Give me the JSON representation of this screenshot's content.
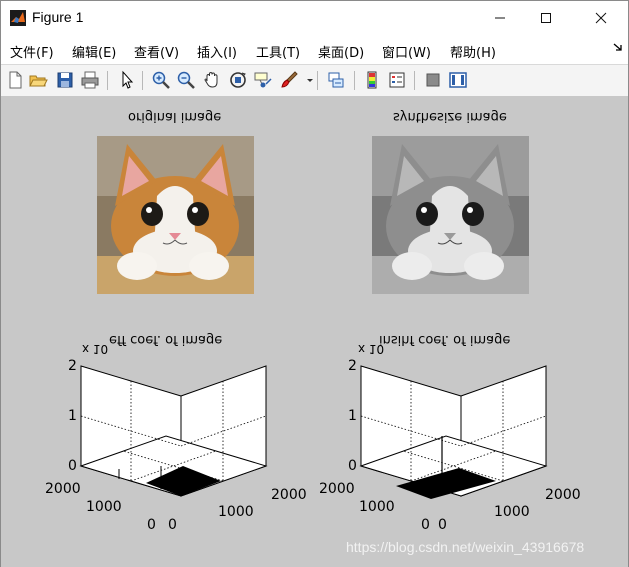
{
  "window": {
    "title": "Figure 1",
    "minimize_glyph": "—",
    "maximize_glyph": "☐",
    "close_glyph": "✕"
  },
  "menu": [
    {
      "label": "文件(F)"
    },
    {
      "label": "编辑(E)"
    },
    {
      "label": "查看(V)"
    },
    {
      "label": "插入(I)"
    },
    {
      "label": "工具(T)"
    },
    {
      "label": "桌面(D)"
    },
    {
      "label": "窗口(W)"
    },
    {
      "label": "帮助(H)"
    }
  ],
  "toolbar_icons": [
    "new-figure-icon",
    "open-file-icon",
    "save-icon",
    "print-icon",
    "pointer-icon",
    "zoom-in-icon",
    "zoom-out-icon",
    "pan-icon",
    "rotate-3d-icon",
    "data-cursor-icon",
    "brush-icon",
    "brush-dropdown-icon",
    "link-plot-icon",
    "colorbar-icon",
    "legend-icon",
    "hide-plot-tools-icon",
    "show-plot-tools-icon"
  ],
  "axes": [
    {
      "title": "original image",
      "image_type": "color cat photo"
    },
    {
      "title": "synthesize image",
      "image_type": "grayscale cat photo"
    }
  ],
  "plots": [
    {
      "title": "eff coef. of image",
      "exponent_label": "x 10",
      "z_ticks": [
        "0",
        "1",
        "2"
      ],
      "y_ticks": [
        "2000",
        "1000",
        "0"
      ],
      "x_ticks": [
        "0",
        "1000",
        "2000"
      ]
    },
    {
      "title": "insihf coef. of image",
      "exponent_label": "x 10",
      "z_ticks": [
        "0",
        "1",
        "2"
      ],
      "y_ticks": [
        "2000",
        "1000",
        "0"
      ],
      "x_ticks": [
        "0",
        "1000",
        "2000"
      ]
    }
  ],
  "watermark": "https://blog.csdn.net/weixin_43916678",
  "colors": {
    "figure_bg": "#c8c8c8",
    "toolbar_bg": "#f4f4f4",
    "axes_bg": "#ffffff",
    "accent_matlab": "#e86a1c"
  }
}
